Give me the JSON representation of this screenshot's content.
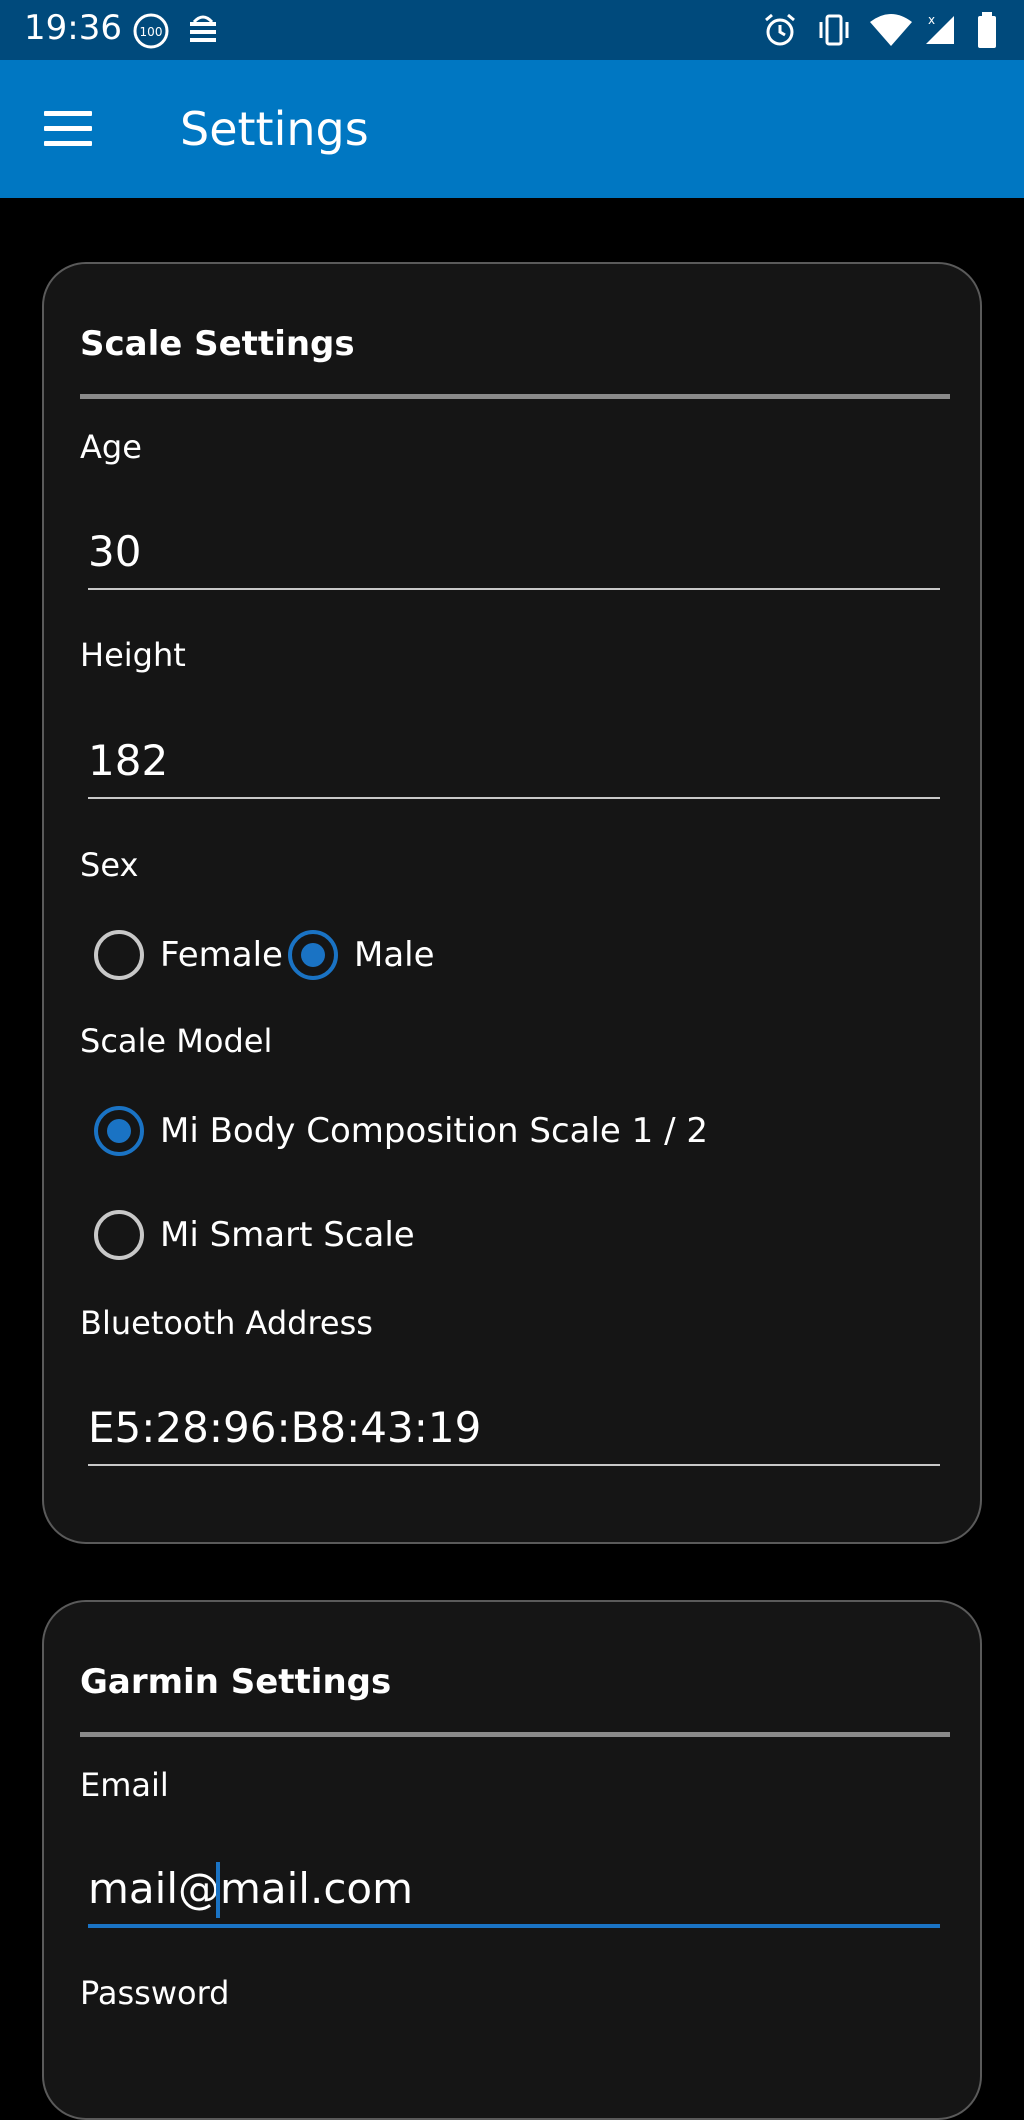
{
  "status_bar": {
    "time": "19:36",
    "icons": [
      "battery-100-badge-icon",
      "network-speed-icon",
      "alarm-icon",
      "vibrate-icon",
      "wifi-icon",
      "cell-signal-icon",
      "battery-icon"
    ]
  },
  "app_bar": {
    "menu_icon": "hamburger-menu-icon",
    "title": "Settings"
  },
  "scale_settings": {
    "title": "Scale Settings",
    "age": {
      "label": "Age",
      "value": "30"
    },
    "height": {
      "label": "Height",
      "value": "182"
    },
    "sex": {
      "label": "Sex",
      "options": [
        {
          "label": "Female",
          "checked": false
        },
        {
          "label": "Male",
          "checked": true
        }
      ]
    },
    "scale_model": {
      "label": "Scale Model",
      "options": [
        {
          "label": "Mi Body Composition Scale 1 / 2",
          "checked": true
        },
        {
          "label": "Mi Smart Scale",
          "checked": false
        }
      ]
    },
    "bluetooth_address": {
      "label": "Bluetooth Address",
      "value": "E5:28:96:B8:43:19"
    }
  },
  "garmin_settings": {
    "title": "Garmin Settings",
    "email": {
      "label": "Email",
      "value": "mail@mail.com"
    },
    "password": {
      "label": "Password"
    }
  },
  "colors": {
    "status_bar": "#004a7c",
    "app_bar": "#0077c2",
    "accent": "#1a73c4",
    "card_bg": "#151515",
    "page_bg": "#000000"
  }
}
